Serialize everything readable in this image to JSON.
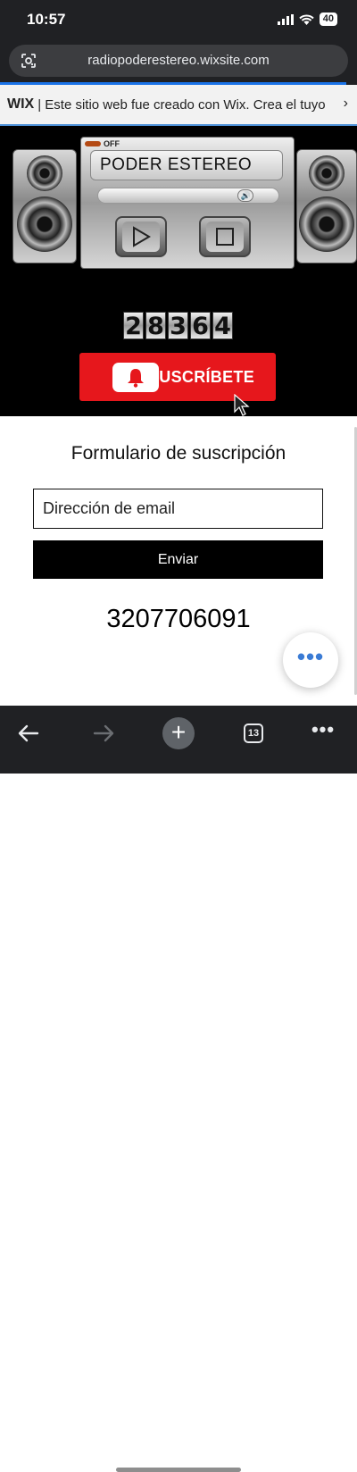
{
  "status_bar": {
    "time": "10:57",
    "battery": "40"
  },
  "browser": {
    "url": "radiopoderestereo.wixsite.com",
    "icons": {
      "lens": "google-lens-icon",
      "back": "back-arrow-icon",
      "forward": "forward-arrow-icon",
      "new_tab": "plus-icon",
      "tabs": "tabs-icon",
      "menu": "more-horizontal-icon"
    },
    "tab_count": "13"
  },
  "wix_banner": {
    "logo": "WIX",
    "text": "| Este sitio web fue creado con Wix. Crea el tuyo"
  },
  "radio": {
    "power_label": "OFF",
    "station": "PODER ESTEREO",
    "volume_level": 0.85
  },
  "counter": {
    "digits": [
      "2",
      "8",
      "3",
      "6",
      "4"
    ]
  },
  "subscribe_button": {
    "label": "SUSCRÍBETE",
    "color": "#e6171c"
  },
  "form": {
    "title": "Formulario de suscripción",
    "email_placeholder": "Dirección de email",
    "submit_label": "Enviar"
  },
  "phone": "3207706091",
  "colors": {
    "accent": "#1a73e8",
    "fab_dots": "#3a7bd5"
  }
}
